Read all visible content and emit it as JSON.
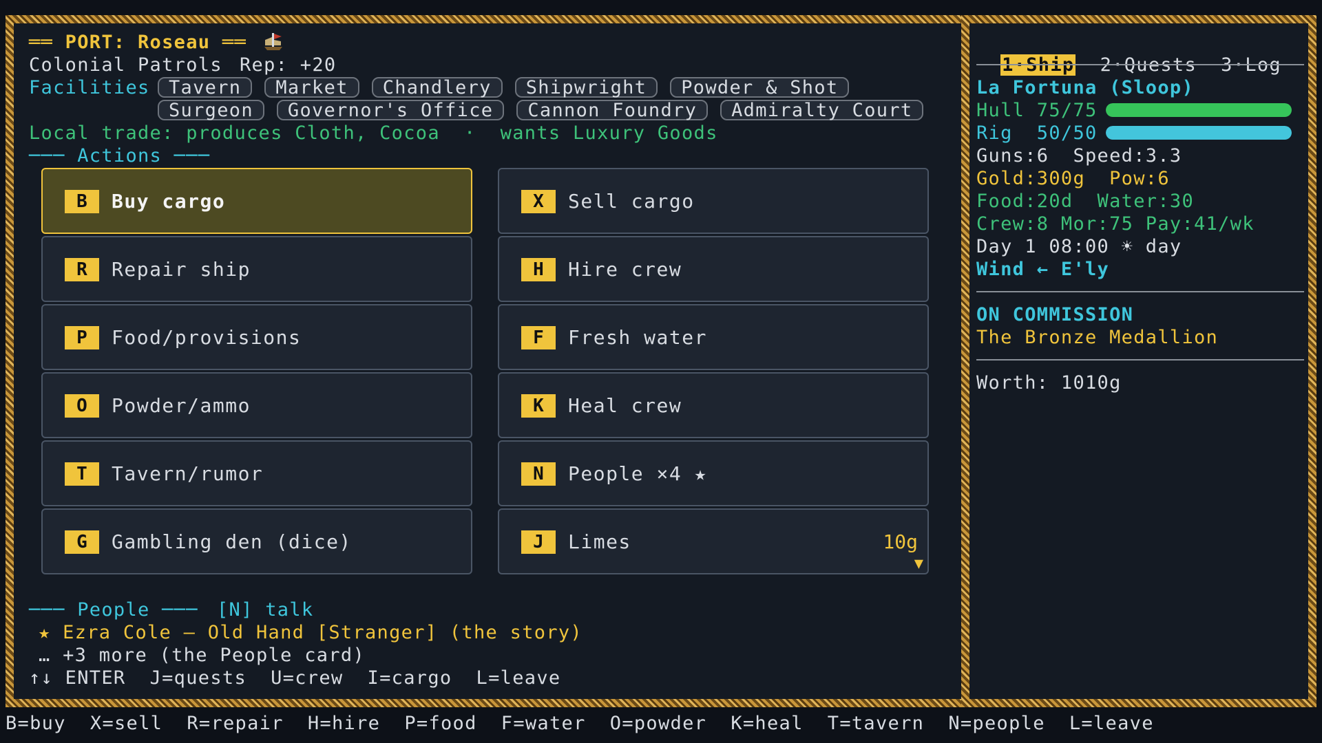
{
  "port": {
    "title": "══ PORT: Roseau ══",
    "faction": "Colonial Patrols",
    "rep": "Rep: +20",
    "facilities_label": "Facilities",
    "facilities": [
      "Tavern",
      "Market",
      "Chandlery",
      "Shipwright",
      "Powder & Shot",
      "Surgeon",
      "Governor's Office",
      "Cannon Foundry",
      "Admiralty Court"
    ],
    "trade": "Local trade: produces Cloth, Cocoa  ·  wants Luxury Goods",
    "actions_header": "─── Actions ───"
  },
  "actions": [
    {
      "key": "B",
      "label": "Buy cargo",
      "selected": true
    },
    {
      "key": "X",
      "label": "Sell cargo"
    },
    {
      "key": "R",
      "label": "Repair ship"
    },
    {
      "key": "H",
      "label": "Hire crew"
    },
    {
      "key": "P",
      "label": "Food/provisions"
    },
    {
      "key": "F",
      "label": "Fresh water"
    },
    {
      "key": "O",
      "label": "Powder/ammo"
    },
    {
      "key": "K",
      "label": "Heal crew"
    },
    {
      "key": "T",
      "label": "Tavern/rumor"
    },
    {
      "key": "N",
      "label": "People ×4 ★"
    },
    {
      "key": "G",
      "label": "Gambling den (dice)"
    },
    {
      "key": "J",
      "label": "Limes",
      "price": "10g"
    }
  ],
  "people": {
    "header": "─── People ───",
    "talk_hint": "[N] talk",
    "featured": "★ Ezra Cole — Old Hand [Stranger] (the story)",
    "more": "… +3 more (the People card)",
    "hints": "↑↓ ENTER  J=quests  U=crew  I=cargo  L=leave"
  },
  "sidebar": {
    "tabs": [
      "1·Ship",
      "2·Quests",
      "3·Log"
    ],
    "ship_name": "La Fortuna (Sloop)",
    "hull_label": "Hull 75/75",
    "hull_value": 1.0,
    "rig_label": "Rig  50/50",
    "rig_value": 1.0,
    "guns_speed": "Guns:6  Speed:3.3",
    "gold_pow": "Gold:300g  Pow:6",
    "food_water": "Food:20d  Water:30",
    "crew": "Crew:8 Mor:75 Pay:41/wk",
    "time": "Day 1 08:00 ☀ day",
    "wind": "Wind ← E'ly",
    "commission_title": "ON COMMISSION",
    "commission_name": "The Bronze Medallion",
    "worth": "Worth: 1010g"
  },
  "statusbar": "B=buy  X=sell  R=repair  H=hire  P=food  F=water  O=powder  K=heal  T=tavern  N=people  L=leave",
  "colors": {
    "accent": "#f0c43c",
    "cyan": "#3fc6dc",
    "green": "#3ec27a",
    "hull_bar": "#36c45a",
    "rig_bar": "#43c5dc"
  },
  "icons": {
    "port_icon": "ship-flag-icon"
  }
}
